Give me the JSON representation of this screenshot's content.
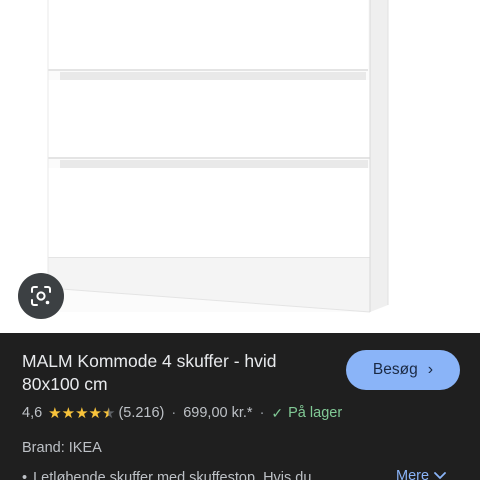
{
  "product": {
    "title": "MALM Kommode 4 skuffer - hvid 80x100 cm",
    "rating": "4,6",
    "review_count": "(5.216)",
    "stars": 4.5,
    "price": "699,00 kr.*",
    "stock": "På lager",
    "brand": "Brand: IKEA",
    "description": "Letløbende skuffer med skuffestop. Hvis du"
  },
  "actions": {
    "visit_label": "Besøg",
    "more_label": "Mere"
  },
  "icons": {
    "lens": "google-lens-icon",
    "visit_chevron": "chevron-right-icon",
    "more_chevron": "chevron-down-icon",
    "star": "star-icon",
    "check": "check-icon"
  },
  "colors": {
    "accent": "#8ab4f8",
    "star": "#f8c33b",
    "in_stock": "#81c995",
    "panel_bg": "#1f1f1f"
  }
}
